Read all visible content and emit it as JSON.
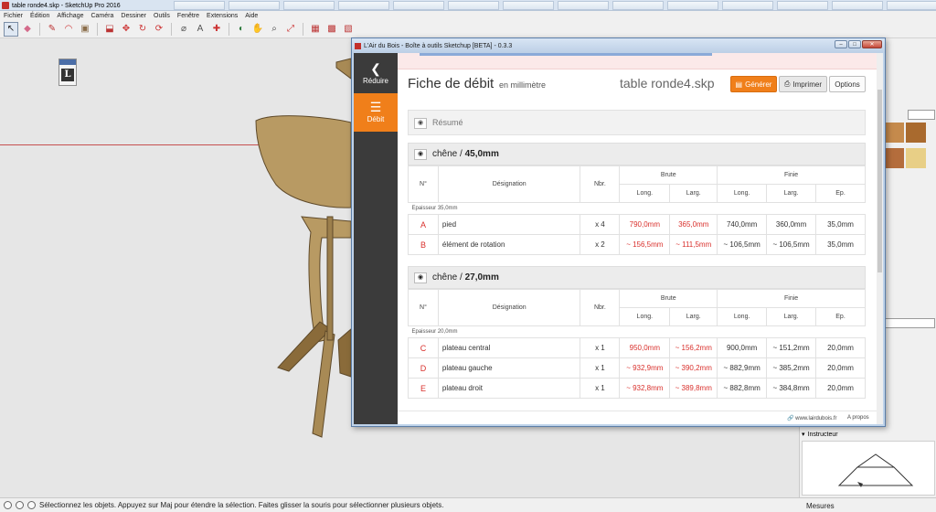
{
  "app": {
    "title": "table ronde4.skp - SketchUp Pro 2016",
    "menu": [
      "Fichier",
      "Édition",
      "Affichage",
      "Caméra",
      "Dessiner",
      "Outils",
      "Fenêtre",
      "Extensions",
      "Aide"
    ],
    "status_text": "Sélectionnez les objets. Appuyez sur Maj pour étendre la sélection. Faites glisser la souris pour sélectionner plusieurs objets.",
    "measures_label": "Mesures",
    "tray_instructor": "Instructeur",
    "toolbar_icons": [
      "select-icon",
      "eraser-icon",
      "pencil-icon",
      "shape-icon",
      "paint-icon",
      "push-pull-icon",
      "move-icon",
      "rotate-icon",
      "offset-icon",
      "tape-icon",
      "text-icon",
      "orbit-icon",
      "pan-icon",
      "zoom-icon",
      "zoom-extents-icon",
      "warehouse-icon",
      "extension-icon",
      "component-icon"
    ]
  },
  "plugin": {
    "window_title": "L'Air du Bois - Boîte à outils Sketchup [BETA] - 0.3.3",
    "sidebar": [
      {
        "label": "Réduire",
        "icon": "chevron-left-icon",
        "glyph": "❮"
      },
      {
        "label": "Débit",
        "icon": "list-document-icon",
        "glyph": "☰"
      }
    ],
    "header": {
      "title": "Fiche de débit",
      "subtitle": "en millimètre",
      "filename": "table ronde4.skp",
      "generate_label": "Générer",
      "print_label": "Imprimer",
      "options_label": "Options"
    },
    "summary_label": "Résumé",
    "columns": {
      "num": "N°",
      "designation": "Désignation",
      "count": "Nbr.",
      "raw": "Brute",
      "finished": "Finie",
      "length": "Long.",
      "width": "Larg.",
      "thickness": "Ep."
    },
    "groups": [
      {
        "material": "chêne",
        "thickness_title": "45,0mm",
        "raw_thickness": "Epaisseur 35,0mm",
        "rows": [
          {
            "id": "A",
            "designation": "pied",
            "count": "x 4",
            "raw_len": "790,0mm",
            "raw_wid": "365,0mm",
            "fin_len": "740,0mm",
            "fin_wid": "360,0mm",
            "fin_thk": "35,0mm"
          },
          {
            "id": "B",
            "designation": "élément de rotation",
            "count": "x 2",
            "raw_len": "~ 156,5mm",
            "raw_wid": "~ 111,5mm",
            "fin_len": "~ 106,5mm",
            "fin_wid": "~ 106,5mm",
            "fin_thk": "35,0mm"
          }
        ]
      },
      {
        "material": "chêne",
        "thickness_title": "27,0mm",
        "raw_thickness": "Epaisseur 20,0mm",
        "rows": [
          {
            "id": "C",
            "designation": "plateau central",
            "count": "x 1",
            "raw_len": "950,0mm",
            "raw_wid": "~ 156,2mm",
            "fin_len": "900,0mm",
            "fin_wid": "~ 151,2mm",
            "fin_thk": "20,0mm"
          },
          {
            "id": "D",
            "designation": "plateau gauche",
            "count": "x 1",
            "raw_len": "~ 932,9mm",
            "raw_wid": "~ 390,2mm",
            "fin_len": "~ 882,9mm",
            "fin_wid": "~ 385,2mm",
            "fin_thk": "20,0mm"
          },
          {
            "id": "E",
            "designation": "plateau droit",
            "count": "x 1",
            "raw_len": "~ 932,8mm",
            "raw_wid": "~ 389,8mm",
            "fin_len": "~ 882,8mm",
            "fin_wid": "~ 384,8mm",
            "fin_thk": "20,0mm"
          }
        ]
      }
    ],
    "footer": {
      "site": "www.lairdubois.fr",
      "about": "A propos"
    }
  },
  "colors": {
    "accent": "#f07f1a",
    "sidebar": "#3b3b3b",
    "raw_value": "#d9302c",
    "wood_light": "#b89a63",
    "wood_dark": "#8a6b3a"
  }
}
